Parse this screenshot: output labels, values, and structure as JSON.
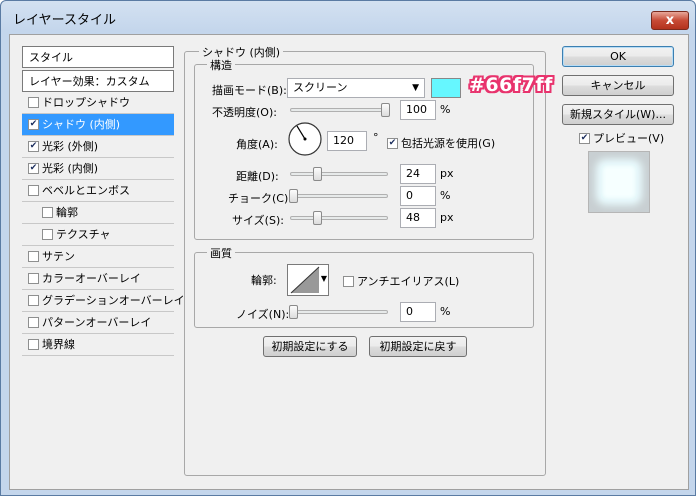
{
  "window": {
    "title": "レイヤースタイル",
    "close": "x"
  },
  "styles_list": {
    "header": "スタイル",
    "blend_options": "レイヤー効果：カスタム",
    "items": [
      {
        "label": "ドロップシャドウ",
        "checked": false
      },
      {
        "label": "シャドウ (内側)",
        "checked": true
      },
      {
        "label": "光彩 (外側)",
        "checked": true
      },
      {
        "label": "光彩 (内側)",
        "checked": true
      },
      {
        "label": "ベベルとエンボス",
        "checked": false
      },
      {
        "label": "輪郭",
        "checked": false
      },
      {
        "label": "テクスチャ",
        "checked": false
      },
      {
        "label": "サテン",
        "checked": false
      },
      {
        "label": "カラーオーバーレイ",
        "checked": false
      },
      {
        "label": "グラデーションオーバーレイ",
        "checked": false
      },
      {
        "label": "パターンオーバーレイ",
        "checked": false
      },
      {
        "label": "境界線",
        "checked": false
      }
    ]
  },
  "panel": {
    "title": "シャドウ (内側)",
    "structure": {
      "title": "構造",
      "blend_mode_label": "描画モード(B):",
      "blend_mode_value": "スクリーン",
      "color": "#66f7ff",
      "color_note": "#66f7ff",
      "opacity_label": "不透明度(O):",
      "opacity_value": "100",
      "opacity_unit": "%",
      "angle_label": "角度(A):",
      "angle_value": "120",
      "angle_unit": "°",
      "global_light_label": "包括光源を使用(G)",
      "global_light_checked": true,
      "distance_label": "距離(D):",
      "distance_value": "24",
      "distance_unit": "px",
      "choke_label": "チョーク(C):",
      "choke_value": "0",
      "choke_unit": "%",
      "size_label": "サイズ(S):",
      "size_value": "48",
      "size_unit": "px"
    },
    "quality": {
      "title": "画質",
      "contour_label": "輪郭:",
      "antialias_label": "アンチエイリアス(L)",
      "antialias_checked": false,
      "noise_label": "ノイズ(N):",
      "noise_value": "0",
      "noise_unit": "%"
    },
    "make_default": "初期設定にする",
    "reset_default": "初期設定に戻す"
  },
  "buttons": {
    "ok": "OK",
    "cancel": "キャンセル",
    "new_style": "新規スタイル(W)...",
    "preview_label": "プレビュー(V)",
    "preview_checked": true
  }
}
